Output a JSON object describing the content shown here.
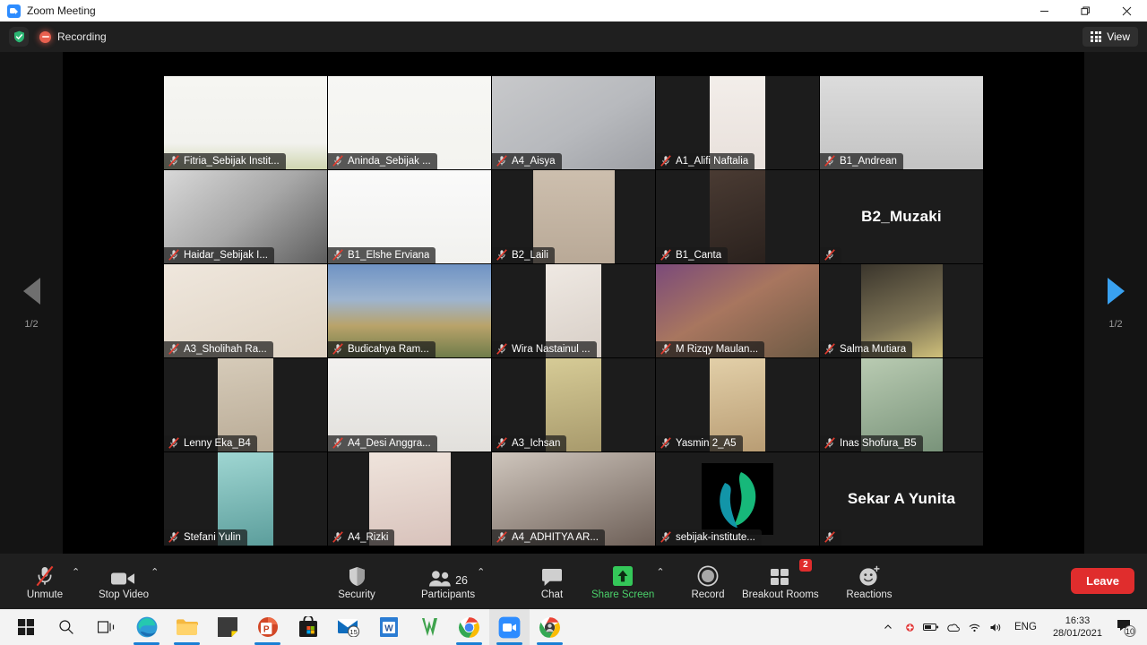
{
  "window": {
    "title": "Zoom Meeting",
    "app_icon": "zoom-icon",
    "minimize": "minimize-icon",
    "maximize": "restore-icon",
    "close": "close-icon"
  },
  "topbar": {
    "shield_icon": "encryption-shield-icon",
    "recording_icon": "recording-dot-icon",
    "recording_label": "Recording",
    "view_icon": "grid-view-icon",
    "view_label": "View"
  },
  "gallery": {
    "prev_label": "1/2",
    "next_label": "1/2",
    "prev_icon": "chevron-left-icon",
    "next_icon": "chevron-right-icon",
    "mute_icon": "mic-muted-icon",
    "participants": [
      {
        "name": "Fitria_Sebijak Instit...",
        "muted": false,
        "active_speaker": true,
        "video": "on",
        "style": "sdg-slide",
        "fit": "full"
      },
      {
        "name": "Aninda_Sebijak ...",
        "muted": true,
        "active_speaker": false,
        "video": "on",
        "style": "sdg-slide-2",
        "fit": "full"
      },
      {
        "name": "A4_Aisya",
        "muted": true,
        "active_speaker": false,
        "video": "on",
        "style": "grey-wall",
        "fit": "full"
      },
      {
        "name": "A1_Alifi Naftalia",
        "muted": true,
        "active_speaker": false,
        "video": "on",
        "style": "party-wall",
        "fit": "pillar-sm"
      },
      {
        "name": "B1_Andrean",
        "muted": true,
        "active_speaker": false,
        "video": "on",
        "style": "tunnel",
        "fit": "full"
      },
      {
        "name": "Haidar_Sebijak I...",
        "muted": true,
        "active_speaker": false,
        "video": "on",
        "style": "office-bw",
        "fit": "full"
      },
      {
        "name": "B1_Elshe Erviana",
        "muted": true,
        "active_speaker": false,
        "video": "on",
        "style": "sdg-slide-3",
        "fit": "full"
      },
      {
        "name": "B2_Laili",
        "muted": true,
        "active_speaker": false,
        "video": "on",
        "style": "tile-wall",
        "fit": "pillar"
      },
      {
        "name": "B1_Canta",
        "muted": true,
        "active_speaker": false,
        "video": "on",
        "style": "dark-room",
        "fit": "pillar-sm"
      },
      {
        "name": "B2_Muzaki",
        "muted": true,
        "active_speaker": false,
        "video": "off",
        "style": "",
        "fit": "full"
      },
      {
        "name": "A3_Sholihah Ra...",
        "muted": true,
        "active_speaker": false,
        "video": "on",
        "style": "white-hijab",
        "fit": "full"
      },
      {
        "name": "Budicahya Ram...",
        "muted": true,
        "active_speaker": false,
        "video": "on",
        "style": "mountain",
        "fit": "full"
      },
      {
        "name": "Wira Nastainul ...",
        "muted": true,
        "active_speaker": false,
        "video": "on",
        "style": "two-people",
        "fit": "pillar-sm"
      },
      {
        "name": "M Rizqy Maulan...",
        "muted": true,
        "active_speaker": false,
        "video": "on",
        "style": "street",
        "fit": "full"
      },
      {
        "name": "Salma Mutiara",
        "muted": true,
        "active_speaker": false,
        "video": "on",
        "style": "yellow-hijab",
        "fit": "pillar"
      },
      {
        "name": "Lenny Eka_B4",
        "muted": true,
        "active_speaker": false,
        "video": "on",
        "style": "curtain",
        "fit": "pillar-sm"
      },
      {
        "name": "A4_Desi Anggra...",
        "muted": true,
        "active_speaker": false,
        "video": "on",
        "style": "white-room",
        "fit": "full"
      },
      {
        "name": "A3_Ichsan",
        "muted": true,
        "active_speaker": false,
        "video": "on",
        "style": "beige-room",
        "fit": "pillar-sm"
      },
      {
        "name": "Yasmin 2_A5",
        "muted": true,
        "active_speaker": false,
        "video": "on",
        "style": "warm-room",
        "fit": "pillar-sm"
      },
      {
        "name": "Inas Shofura_B5",
        "muted": true,
        "active_speaker": false,
        "video": "on",
        "style": "green-wall",
        "fit": "pillar"
      },
      {
        "name": "Stefani Yulin",
        "muted": true,
        "active_speaker": false,
        "video": "on",
        "style": "teal-curtain",
        "fit": "pillar-sm"
      },
      {
        "name": "A4_Rizki",
        "muted": true,
        "active_speaker": false,
        "video": "on",
        "style": "pink-room",
        "fit": "pillar"
      },
      {
        "name": "A4_ADHITYA AR...",
        "muted": true,
        "active_speaker": false,
        "video": "on",
        "style": "dim-room",
        "fit": "full"
      },
      {
        "name": "sebijak-institute...",
        "muted": true,
        "active_speaker": false,
        "video": "avatar",
        "style": "sebijak-logo",
        "fit": "full"
      },
      {
        "name": "Sekar A Yunita",
        "muted": false,
        "active_speaker": false,
        "video": "off",
        "style": "",
        "fit": "full"
      }
    ]
  },
  "toolbar": {
    "items": [
      {
        "label": "Unmute",
        "icon": "mic-muted-icon",
        "caret": true,
        "accent": "default"
      },
      {
        "label": "Stop Video",
        "icon": "camera-icon",
        "caret": true,
        "accent": "default"
      },
      {
        "label": "Security",
        "icon": "shield-icon",
        "caret": false,
        "accent": "default"
      },
      {
        "label": "Participants",
        "icon": "participants-icon",
        "caret": true,
        "accent": "default",
        "count": "26"
      },
      {
        "label": "Chat",
        "icon": "chat-bubble-icon",
        "caret": false,
        "accent": "default"
      },
      {
        "label": "Share Screen",
        "icon": "share-screen-icon",
        "caret": true,
        "accent": "green"
      },
      {
        "label": "Record",
        "icon": "record-icon",
        "caret": false,
        "accent": "default"
      },
      {
        "label": "Breakout Rooms",
        "icon": "breakout-rooms-icon",
        "caret": false,
        "accent": "default",
        "badge": "2"
      },
      {
        "label": "Reactions",
        "icon": "reactions-icon",
        "caret": false,
        "accent": "default"
      }
    ],
    "leave_label": "Leave"
  },
  "taskbar": {
    "apps": [
      {
        "name": "start-button",
        "open": false,
        "active": false
      },
      {
        "name": "search-icon",
        "open": false,
        "active": false
      },
      {
        "name": "task-view-icon",
        "open": false,
        "active": false
      },
      {
        "name": "edge-icon",
        "open": true,
        "active": false
      },
      {
        "name": "file-explorer-icon",
        "open": true,
        "active": false
      },
      {
        "name": "sticky-notes-icon",
        "open": false,
        "active": false
      },
      {
        "name": "powerpoint-icon",
        "open": true,
        "active": false
      },
      {
        "name": "microsoft-store-icon",
        "open": false,
        "active": false
      },
      {
        "name": "mail-icon",
        "open": false,
        "active": false,
        "badge": "15"
      },
      {
        "name": "word-icon",
        "open": false,
        "active": false
      },
      {
        "name": "wps-icon",
        "open": false,
        "active": false
      },
      {
        "name": "chrome-icon",
        "open": true,
        "active": false
      },
      {
        "name": "zoom-icon",
        "open": true,
        "active": true
      },
      {
        "name": "chrome-profile-icon",
        "open": true,
        "active": false
      }
    ],
    "tray": {
      "show_hidden_icon": "chevron-up-icon",
      "antivirus_icon": "antivirus-icon",
      "battery_icon": "battery-icon",
      "onedrive_icon": "onedrive-icon",
      "network_icon": "wifi-icon",
      "volume_icon": "speaker-icon",
      "language": "ENG",
      "time": "16:33",
      "date": "28/01/2021",
      "notification_icon": "notification-icon",
      "notification_count": "10"
    }
  }
}
